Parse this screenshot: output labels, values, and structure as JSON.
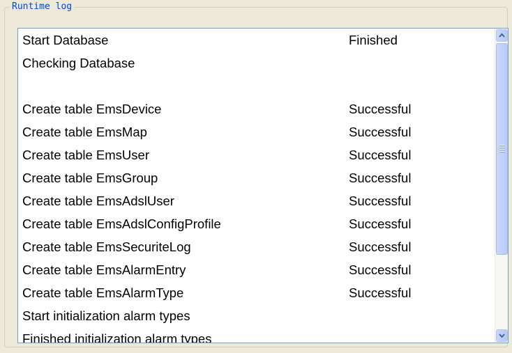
{
  "group": {
    "title": "Runtime log"
  },
  "log": {
    "rows": [
      {
        "name": "Start Database",
        "status": "Finished"
      },
      {
        "name": "Checking Database",
        "status": ""
      },
      {
        "name": "",
        "status": ""
      },
      {
        "name": "Create table EmsDevice",
        "status": "Successful"
      },
      {
        "name": "Create table EmsMap",
        "status": "Successful"
      },
      {
        "name": "Create table EmsUser",
        "status": "Successful"
      },
      {
        "name": "Create table EmsGroup",
        "status": "Successful"
      },
      {
        "name": "Create table EmsAdslUser",
        "status": "Successful"
      },
      {
        "name": "Create table EmsAdslConfigProfile",
        "status": "Successful"
      },
      {
        "name": "Create table EmsSecuriteLog",
        "status": "Successful"
      },
      {
        "name": "Create table EmsAlarmEntry",
        "status": "Successful"
      },
      {
        "name": "Create table EmsAlarmType",
        "status": "Successful"
      },
      {
        "name": "Start initialization alarm types",
        "status": ""
      },
      {
        "name": "Finished initialization alarm types",
        "status": ""
      }
    ]
  },
  "icons": {
    "scroll_up": "chevron-up-icon",
    "scroll_down": "chevron-down-icon",
    "thumb_grip": "grip-icon"
  },
  "colors": {
    "legend_text": "#0046d5",
    "list_border": "#7f9db9",
    "scrollbar_blue": "#b4c8f6",
    "window_bg": "#ece9d8"
  }
}
